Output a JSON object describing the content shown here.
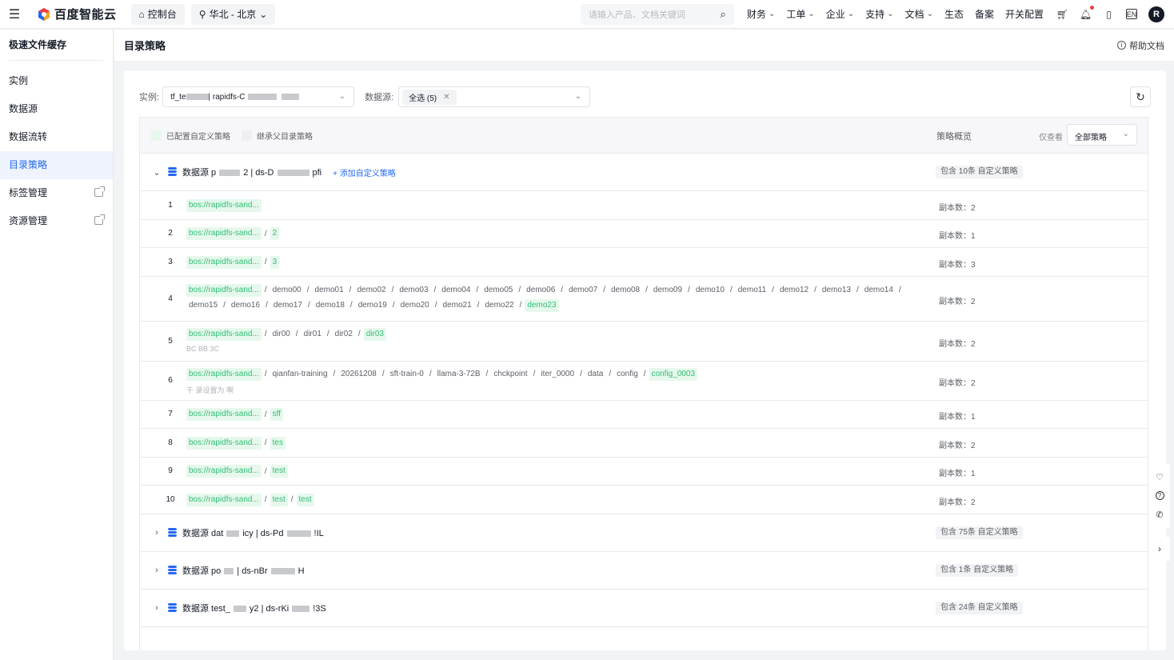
{
  "topnav": {
    "brand": "百度智能云",
    "console": "控制台",
    "region": "华北 - 北京",
    "search_placeholder": "请输入产品、文档关键词",
    "menu": [
      "财务",
      "工单",
      "企业",
      "支持",
      "文档",
      "生态",
      "备案",
      "开关配置"
    ],
    "menu_dropdown": [
      true,
      true,
      true,
      true,
      true,
      false,
      false,
      false
    ],
    "lang": "EN",
    "avatar": "R"
  },
  "sidebar": {
    "title": "极速文件缓存",
    "items": [
      {
        "label": "实例",
        "active": false,
        "external": false
      },
      {
        "label": "数据源",
        "active": false,
        "external": false
      },
      {
        "label": "数据流转",
        "active": false,
        "external": false
      },
      {
        "label": "目录策略",
        "active": true,
        "external": false
      },
      {
        "label": "标签管理",
        "active": false,
        "external": true
      },
      {
        "label": "资源管理",
        "active": false,
        "external": true
      }
    ]
  },
  "page": {
    "title": "目录策略",
    "help": "帮助文档"
  },
  "filters": {
    "instance_label": "实例:",
    "instance_prefix": "tf_te",
    "instance_mid": "| rapidfs-C",
    "datasource_label": "数据源:",
    "datasource_tag": "全选 (5)"
  },
  "table": {
    "legend_custom": "已配置自定义策略",
    "legend_inherit": "继承父目录策略",
    "overview_header": "策略概览",
    "view_label": "仅查看",
    "view_value": "全部策略",
    "add_custom": "添加自定义策略",
    "groups": [
      {
        "name_a": "数据源 p",
        "name_b": "2 | ds-D",
        "name_c": "pfi",
        "badge": "包含 10条 自定义策略",
        "expanded": true,
        "rows": [
          {
            "idx": "1",
            "segs": [
              {
                "t": "bos://rapidfs-sand...",
                "hl": true
              }
            ],
            "copies": "副本数：2"
          },
          {
            "idx": "2",
            "segs": [
              {
                "t": "bos://rapidfs-sand...",
                "hl": true
              },
              {
                "t": "2",
                "hl": true
              }
            ],
            "copies": "副本数：1"
          },
          {
            "idx": "3",
            "segs": [
              {
                "t": "bos://rapidfs-sand...",
                "hl": true
              },
              {
                "t": "3",
                "hl": true
              }
            ],
            "copies": "副本数：3"
          },
          {
            "idx": "4",
            "segs": [
              {
                "t": "bos://rapidfs-sand...",
                "hl": true
              },
              {
                "t": "demo00"
              },
              {
                "t": "demo01"
              },
              {
                "t": "demo02"
              },
              {
                "t": "demo03"
              },
              {
                "t": "demo04"
              },
              {
                "t": "demo05"
              },
              {
                "t": "demo06"
              },
              {
                "t": "demo07"
              },
              {
                "t": "demo08"
              },
              {
                "t": "demo09"
              },
              {
                "t": "demo10"
              },
              {
                "t": "demo11"
              },
              {
                "t": "demo12"
              },
              {
                "t": "demo13"
              },
              {
                "t": "demo14"
              },
              {
                "t": "demo15"
              },
              {
                "t": "demo16"
              },
              {
                "t": "demo17"
              },
              {
                "t": "demo18"
              },
              {
                "t": "demo19"
              },
              {
                "t": "demo20"
              },
              {
                "t": "demo21"
              },
              {
                "t": "demo22"
              },
              {
                "t": "demo23",
                "hl": true
              }
            ],
            "copies": "副本数：2"
          },
          {
            "idx": "5",
            "segs": [
              {
                "t": "bos://rapidfs-sand...",
                "hl": true
              },
              {
                "t": "dir00"
              },
              {
                "t": "dir01"
              },
              {
                "t": "dir02"
              },
              {
                "t": "dir03",
                "hl": true
              }
            ],
            "note": "BC    BB    3C",
            "copies": "副本数：2"
          },
          {
            "idx": "6",
            "segs": [
              {
                "t": "bos://rapidfs-sand...",
                "hl": true
              },
              {
                "t": "qianfan-training"
              },
              {
                "t": "20261208"
              },
              {
                "t": "sft-train-0"
              },
              {
                "t": "llama-3-72B"
              },
              {
                "t": "chckpoint"
              },
              {
                "t": "iter_0000"
              },
              {
                "t": "data"
              },
              {
                "t": "config"
              },
              {
                "t": "config_0003",
                "hl": true
              }
            ],
            "note": "千      录设置为             啊",
            "copies": "副本数：2"
          },
          {
            "idx": "7",
            "segs": [
              {
                "t": "bos://rapidfs-sand...",
                "hl": true
              },
              {
                "t": "sff",
                "hl": true
              }
            ],
            "copies": "副本数：1"
          },
          {
            "idx": "8",
            "segs": [
              {
                "t": "bos://rapidfs-sand...",
                "hl": true
              },
              {
                "t": "tes",
                "hl": true
              }
            ],
            "copies": "副本数：2"
          },
          {
            "idx": "9",
            "segs": [
              {
                "t": "bos://rapidfs-sand...",
                "hl": true
              },
              {
                "t": "test",
                "hl": true
              }
            ],
            "copies": "副本数：1"
          },
          {
            "idx": "10",
            "segs": [
              {
                "t": "bos://rapidfs-sand...",
                "hl": true
              },
              {
                "t": "test",
                "hl": true
              },
              {
                "t": "test",
                "hl": true
              }
            ],
            "copies": "副本数：2"
          }
        ]
      },
      {
        "name_a": "数据源 dat",
        "name_b": "icy | ds-Pd",
        "name_c": "!IL",
        "badge": "包含 75条 自定义策略",
        "expanded": false
      },
      {
        "name_a": "数据源 po",
        "name_b": "| ds-nBr",
        "name_c": "H",
        "badge": "包含 1条 自定义策略",
        "expanded": false
      },
      {
        "name_a": "数据源 test_",
        "name_b": "y2 | ds-rKi",
        "name_c": "!3S",
        "badge": "包含 24条 自定义策略",
        "expanded": false
      }
    ]
  },
  "colors": {
    "primary": "#2468f2",
    "highlight_bg": "#e6f8ec",
    "highlight_text": "#30bf76"
  }
}
